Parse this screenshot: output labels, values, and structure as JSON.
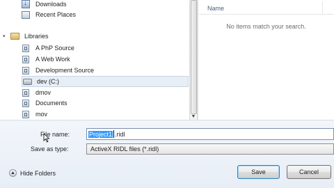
{
  "nav": {
    "items": [
      {
        "label": "Downloads",
        "icon": "downloads-icon"
      },
      {
        "label": "Recent Places",
        "icon": "recent-places-icon"
      },
      {
        "label": "Libraries",
        "icon": "libraries-icon"
      },
      {
        "label": "A PhP Source",
        "icon": "library-icon"
      },
      {
        "label": "A Web Work",
        "icon": "library-icon"
      },
      {
        "label": "Development Source",
        "icon": "library-icon"
      },
      {
        "label": "dev (C:)",
        "icon": "drive-icon"
      },
      {
        "label": "dmov",
        "icon": "library-icon"
      },
      {
        "label": "Documents",
        "icon": "library-icon"
      },
      {
        "label": "mov",
        "icon": "library-icon"
      }
    ]
  },
  "list": {
    "column_name": "Name",
    "empty_message": "No items match your search."
  },
  "form": {
    "filename_label": "File name:",
    "filename_selected": "Project1",
    "filename_rest": ".ridl",
    "savetype_label": "Save as type:",
    "savetype_value": "ActiveX RIDL files (*.ridl)"
  },
  "footer": {
    "hide_folders": "Hide Folders",
    "save": "Save",
    "cancel": "Cancel"
  },
  "colors": {
    "selection": "#3399ff",
    "selected_nav": "#e8eef5",
    "bottom_bg": "#eef3f9"
  }
}
